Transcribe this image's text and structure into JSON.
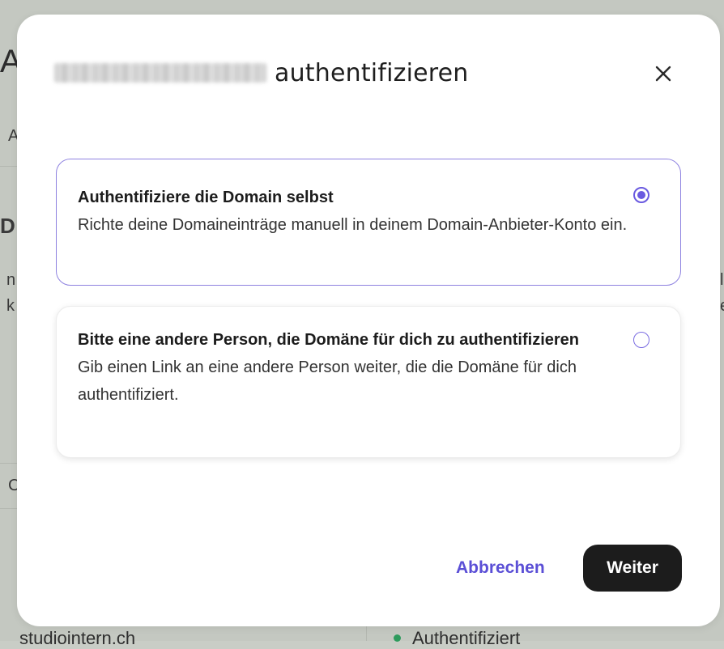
{
  "background": {
    "fragments": {
      "heading_initial": "A",
      "tab_initial": "A",
      "section_initial": "D",
      "text_initial_1": "n",
      "text_initial_2": "k",
      "text_right_1": "l",
      "text_right_2": "e",
      "row_initial": "C"
    },
    "domain_row": {
      "domain": "studiointern.ch",
      "status": "Authentifiziert",
      "status_color": "#2e9b5d"
    }
  },
  "modal": {
    "title_suffix": "authentifizieren",
    "close_icon": "close-icon",
    "options": [
      {
        "title": "Authentifiziere die Domain selbst",
        "description": "Richte deine Domaineinträge manuell in deinem Domain-Anbieter-Konto ein.",
        "selected": true
      },
      {
        "title": "Bitte eine andere Person, die Domäne für dich zu authentifizieren",
        "description": "Gib einen Link an eine andere Person weiter, die die Domäne für dich authentifiziert.",
        "selected": false
      }
    ],
    "cancel_label": "Abbrechen",
    "continue_label": "Weiter"
  },
  "colors": {
    "accent": "#6a5ae0",
    "primary_button": "#1c1c1c",
    "overlay_background": "#c4c8c1"
  }
}
